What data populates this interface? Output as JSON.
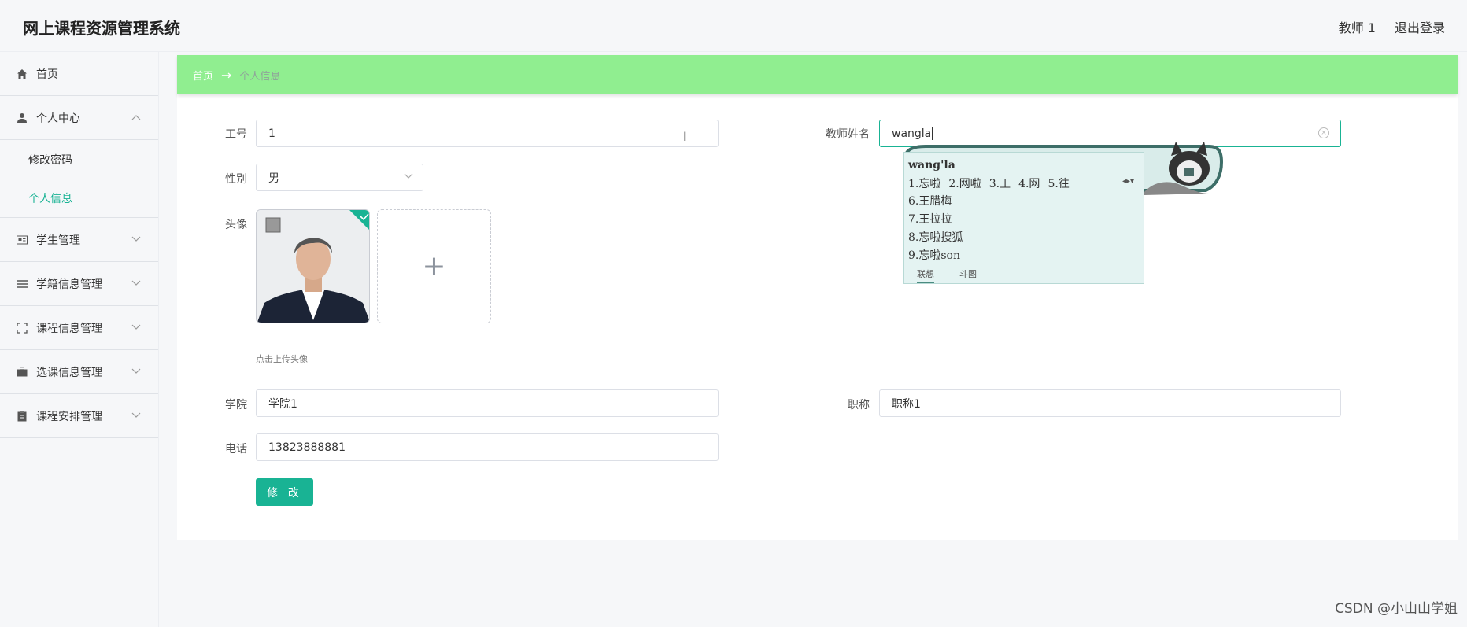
{
  "header": {
    "title": "网上课程资源管理系统",
    "user": "教师 1",
    "logout": "退出登录"
  },
  "sidebar": {
    "home": "首页",
    "personal_center": "个人中心",
    "change_password": "修改密码",
    "personal_info": "个人信息",
    "student_mgmt": "学生管理",
    "roll_mgmt": "学籍信息管理",
    "course_mgmt": "课程信息管理",
    "elective_mgmt": "选课信息管理",
    "schedule_mgmt": "课程安排管理"
  },
  "breadcrumb": {
    "home": "首页",
    "arrow": "→",
    "current": "个人信息"
  },
  "form": {
    "job_no_label": "工号",
    "job_no_value": "1",
    "teacher_name_label": "教师姓名",
    "teacher_name_value": "wangla",
    "gender_label": "性别",
    "gender_value": "男",
    "avatar_label": "头像",
    "upload_tip": "点击上传头像",
    "college_label": "学院",
    "college_value": "学院1",
    "title_label": "职称",
    "title_value": "职称1",
    "phone_label": "电话",
    "phone_value": "13823888881",
    "submit": "修 改"
  },
  "ime": {
    "pinyin": "wang'la",
    "c1": "1.忘啦",
    "c2": "2.网啦",
    "c3": "3.王",
    "c4": "4.网",
    "c5": "5.往",
    "c6": "6.王腊梅",
    "c7": "7.王拉拉",
    "c8": "8.忘啦搜狐",
    "c9": "9.忘啦son",
    "tab1": "联想",
    "tab2": "斗图"
  },
  "watermark": "CSDN @小山山学姐",
  "colors": {
    "accent": "#19b394",
    "breadcrumb_bg": "#90ee90"
  }
}
